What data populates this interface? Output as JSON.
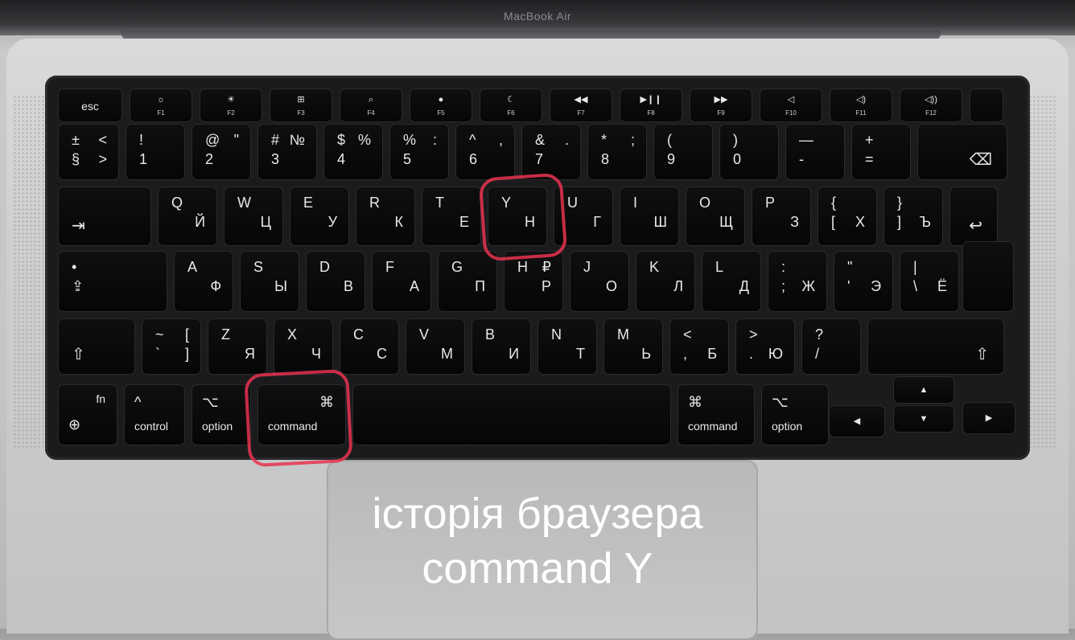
{
  "device": {
    "brand": "MacBook Air"
  },
  "function_row": [
    {
      "id": "esc",
      "label": "esc"
    },
    {
      "id": "f1",
      "icon": "☼",
      "icon_name": "brightness-down-icon",
      "label": "F1"
    },
    {
      "id": "f2",
      "icon": "☀",
      "icon_name": "brightness-up-icon",
      "label": "F2"
    },
    {
      "id": "f3",
      "icon": "⊞",
      "icon_name": "mission-control-icon",
      "label": "F3"
    },
    {
      "id": "f4",
      "icon": "⌕",
      "icon_name": "spotlight-icon",
      "label": "F4"
    },
    {
      "id": "f5",
      "icon": "●",
      "icon_name": "dictation-icon",
      "label": "F5"
    },
    {
      "id": "f6",
      "icon": "☾",
      "icon_name": "do-not-disturb-icon",
      "label": "F6"
    },
    {
      "id": "f7",
      "icon": "◀◀",
      "icon_name": "rewind-icon",
      "label": "F7"
    },
    {
      "id": "f8",
      "icon": "▶❙❙",
      "icon_name": "play-pause-icon",
      "label": "F8"
    },
    {
      "id": "f9",
      "icon": "▶▶",
      "icon_name": "fast-forward-icon",
      "label": "F9"
    },
    {
      "id": "f10",
      "icon": "◁",
      "icon_name": "mute-icon",
      "label": "F10"
    },
    {
      "id": "f11",
      "icon": "◁)",
      "icon_name": "volume-down-icon",
      "label": "F11"
    },
    {
      "id": "f12",
      "icon": "◁))",
      "icon_name": "volume-up-icon",
      "label": "F12"
    },
    {
      "id": "touchid",
      "label": ""
    }
  ],
  "number_row": [
    {
      "id": "section",
      "tl": "±",
      "bl": "§",
      "tr": "<",
      "br": ">"
    },
    {
      "id": "1",
      "tl": "!",
      "bl": "1"
    },
    {
      "id": "2",
      "tl": "@",
      "bl": "2",
      "tr": "\""
    },
    {
      "id": "3",
      "tl": "#",
      "bl": "3",
      "tr": "№"
    },
    {
      "id": "4",
      "tl": "$",
      "bl": "4",
      "tr": "%"
    },
    {
      "id": "5",
      "tl": "%",
      "bl": "5",
      "tr": ":"
    },
    {
      "id": "6",
      "tl": "^",
      "bl": "6",
      "tr": ","
    },
    {
      "id": "7",
      "tl": "&",
      "bl": "7",
      "tr": "."
    },
    {
      "id": "8",
      "tl": "*",
      "bl": "8",
      "tr": ";"
    },
    {
      "id": "9",
      "tl": "(",
      "bl": "9"
    },
    {
      "id": "0",
      "tl": ")",
      "bl": "0"
    },
    {
      "id": "minus",
      "tl": "—",
      "bl": "-"
    },
    {
      "id": "equal",
      "tl": "+",
      "bl": "="
    },
    {
      "id": "delete",
      "sym": "⌫",
      "icon_name": "delete-icon"
    }
  ],
  "top_row": [
    {
      "id": "tab",
      "sym": "⇥",
      "icon_name": "tab-icon"
    },
    {
      "id": "q",
      "tl": "Q",
      "br": "Й"
    },
    {
      "id": "w",
      "tl": "W",
      "br": "Ц"
    },
    {
      "id": "e",
      "tl": "E",
      "br": "У"
    },
    {
      "id": "r",
      "tl": "R",
      "br": "К"
    },
    {
      "id": "t",
      "tl": "T",
      "br": "Е"
    },
    {
      "id": "y",
      "tl": "Y",
      "br": "Н"
    },
    {
      "id": "u",
      "tl": "U",
      "br": "Г"
    },
    {
      "id": "i",
      "tl": "I",
      "br": "Ш"
    },
    {
      "id": "o",
      "tl": "O",
      "br": "Щ"
    },
    {
      "id": "p",
      "tl": "P",
      "br": "З"
    },
    {
      "id": "lbracket",
      "tl": "{",
      "bl": "[",
      "br": "Х"
    },
    {
      "id": "rbracket",
      "tl": "}",
      "bl": "]",
      "br": "Ъ"
    },
    {
      "id": "return",
      "sym": "↩",
      "icon_name": "return-icon"
    }
  ],
  "home_row": [
    {
      "id": "capslock",
      "tl": "•",
      "bl": "⇪",
      "icon_name": "caps-lock-icon"
    },
    {
      "id": "a",
      "tl": "A",
      "br": "Ф"
    },
    {
      "id": "s",
      "tl": "S",
      "br": "Ы"
    },
    {
      "id": "d",
      "tl": "D",
      "br": "В"
    },
    {
      "id": "f",
      "tl": "F",
      "br": "А"
    },
    {
      "id": "g",
      "tl": "G",
      "br": "П"
    },
    {
      "id": "h",
      "tl": "H",
      "tr": "₽",
      "br": "Р"
    },
    {
      "id": "j",
      "tl": "J",
      "br": "О"
    },
    {
      "id": "k",
      "tl": "K",
      "br": "Л"
    },
    {
      "id": "l",
      "tl": "L",
      "br": "Д"
    },
    {
      "id": "semicolon",
      "tl": ":",
      "bl": ";",
      "br": "Ж"
    },
    {
      "id": "quote",
      "tl": "\"",
      "bl": "'",
      "br": "Э"
    },
    {
      "id": "backslash",
      "tl": "|",
      "bl": "\\",
      "br": "Ё"
    }
  ],
  "bottom_row": [
    {
      "id": "lshift",
      "sym": "⇧",
      "icon_name": "shift-icon"
    },
    {
      "id": "tilde",
      "tl": "~",
      "bl": "`",
      "tr": "[",
      "br": "]"
    },
    {
      "id": "z",
      "tl": "Z",
      "br": "Я"
    },
    {
      "id": "x",
      "tl": "X",
      "br": "Ч"
    },
    {
      "id": "c",
      "tl": "C",
      "br": "С"
    },
    {
      "id": "v",
      "tl": "V",
      "br": "М"
    },
    {
      "id": "b",
      "tl": "B",
      "br": "И"
    },
    {
      "id": "n",
      "tl": "N",
      "br": "Т"
    },
    {
      "id": "m",
      "tl": "M",
      "br": "Ь"
    },
    {
      "id": "comma",
      "tl": "<",
      "bl": ",",
      "br": "Б"
    },
    {
      "id": "period",
      "tl": ">",
      "bl": ".",
      "br": "Ю"
    },
    {
      "id": "slash",
      "tl": "?",
      "bl": "/"
    },
    {
      "id": "rshift",
      "sym": "⇧",
      "icon_name": "shift-icon"
    }
  ],
  "modifier_row": [
    {
      "id": "fn",
      "sym": "fn",
      "lbl": "⊕",
      "icon_name": "globe-icon"
    },
    {
      "id": "control",
      "sym": "^",
      "lbl": "control"
    },
    {
      "id": "option-left",
      "sym": "⌥",
      "lbl": "option"
    },
    {
      "id": "command-left",
      "sym": "⌘",
      "lbl": "command"
    },
    {
      "id": "space",
      "sym": "",
      "lbl": ""
    },
    {
      "id": "command-right",
      "sym": "⌘",
      "lbl": "command"
    },
    {
      "id": "option-right",
      "sym": "⌥",
      "lbl": "option"
    }
  ],
  "arrows": {
    "up": "▲",
    "down": "▼",
    "left": "◀",
    "right": "▶"
  },
  "caption": {
    "line1": "історія браузера",
    "line2": "command Y"
  },
  "colors": {
    "highlight": "#e8324f",
    "key": "#0a0a0b",
    "key_text": "#e9e9ea"
  }
}
